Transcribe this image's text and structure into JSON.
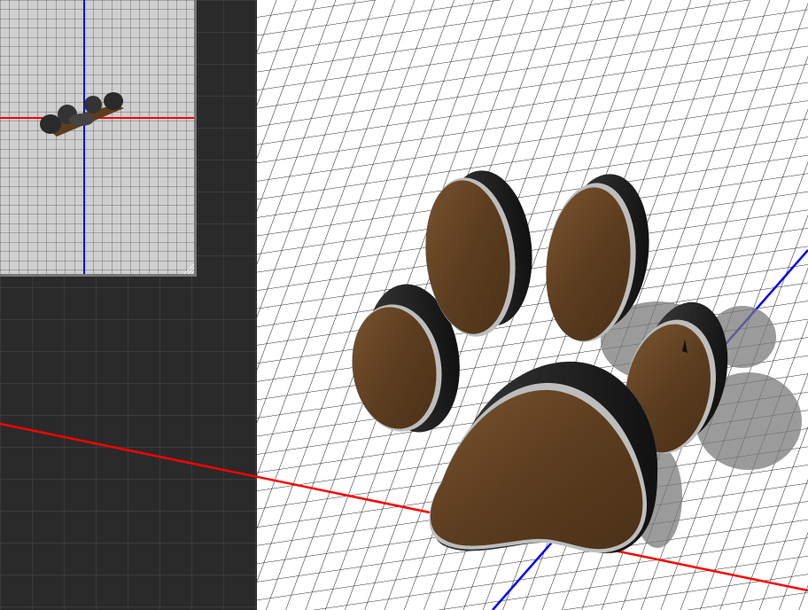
{
  "viewport": {
    "theme": "3d-modeling-perspective",
    "background_color": "#2a2a2a",
    "grid_dark_color": "#4a4a4a",
    "grid_light_color": "#111111",
    "floor_color": "#ffffff",
    "x_axis_color": "#ff0000",
    "z_axis_color": "#0000ff"
  },
  "inset_view": {
    "kind": "orthographic-top-view",
    "background_color": "#cfcfcf",
    "grid_color": "#555555",
    "frame_color": "#777777"
  },
  "model": {
    "name": "paw-print",
    "pad_color": "#5c3d1f",
    "pad_highlight": "#7a552f",
    "rim_color": "#bdbdbd",
    "side_color": "#1f1f1f",
    "shadow_color": "#7a7a7a"
  }
}
